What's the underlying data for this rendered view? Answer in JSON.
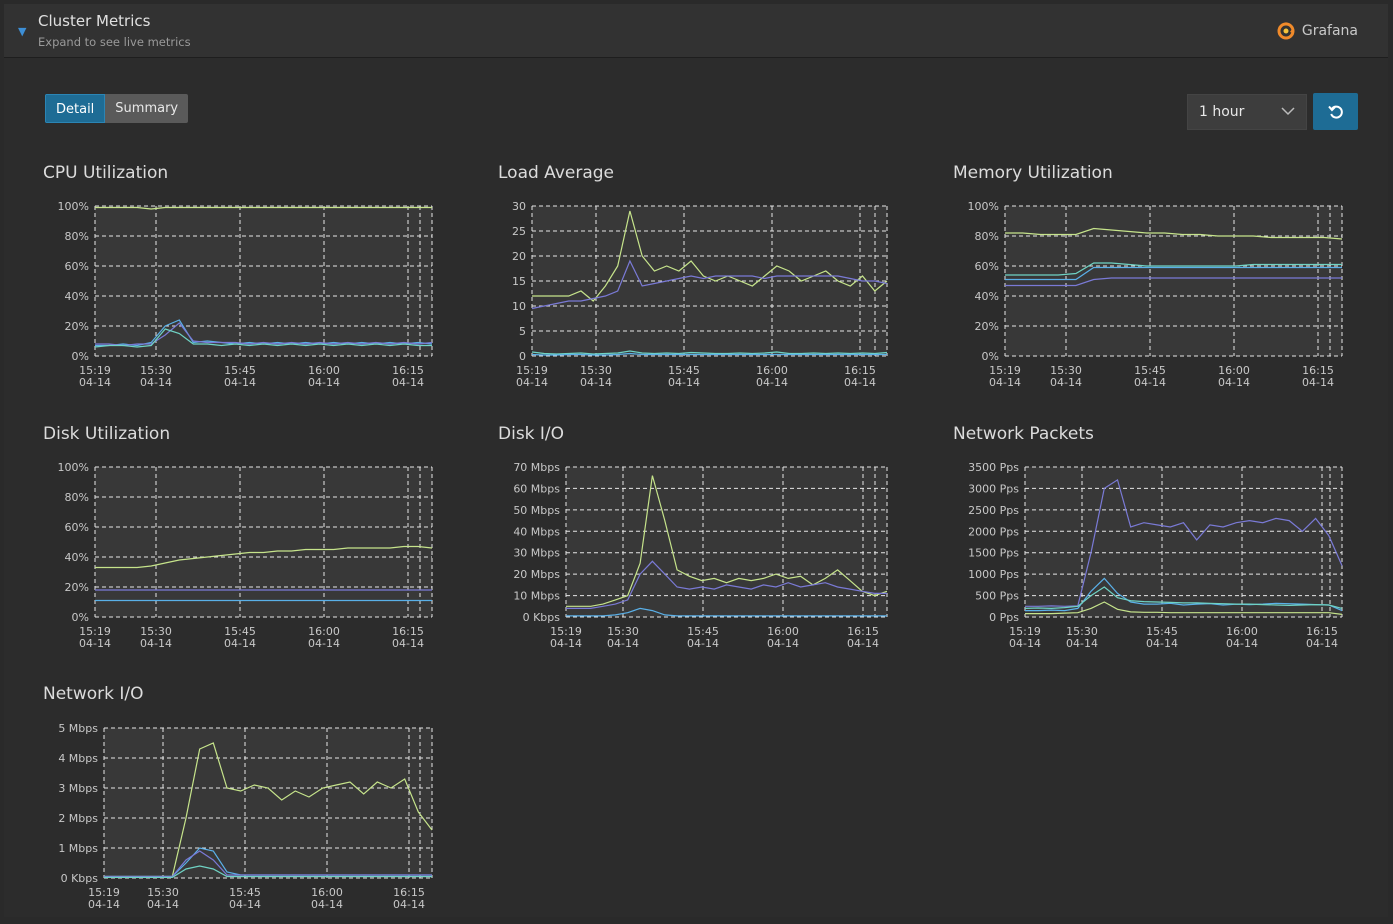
{
  "header": {
    "title": "Cluster Metrics",
    "subtitle": "Expand to see live metrics",
    "brand": "Grafana"
  },
  "view_toggle": {
    "detail": "Detail",
    "summary": "Summary",
    "selected": "Detail"
  },
  "time_range": {
    "value": "1 hour"
  },
  "colors": {
    "green": "#c6e48b",
    "purple": "#7a7ad6",
    "blue": "#5ab0e8",
    "teal": "#6fd3c4",
    "grid": "#e6e6e6",
    "plot_bg": "#383838",
    "accent": "#1e6c95"
  },
  "chart_data": [
    {
      "id": "cpu",
      "title": "CPU Utilization",
      "type": "line",
      "yticks": [
        "0%",
        "20%",
        "40%",
        "60%",
        "80%",
        "100%"
      ],
      "ylim": [
        0,
        100
      ],
      "xticks": [
        {
          "t": "15:19",
          "d": "04-14"
        },
        {
          "t": "15:30",
          "d": "04-14"
        },
        {
          "t": "15:45",
          "d": "04-14"
        },
        {
          "t": "16:00",
          "d": "04-14"
        },
        {
          "t": "16:15",
          "d": "04-14"
        }
      ],
      "series": [
        {
          "color": "green",
          "values": [
            99,
            99,
            99,
            99,
            98,
            99,
            99,
            99,
            99,
            99,
            99,
            99,
            99,
            99,
            99,
            99,
            99,
            99,
            99,
            99,
            99,
            99,
            99,
            99,
            99
          ]
        },
        {
          "color": "blue",
          "values": [
            7,
            7,
            8,
            7,
            9,
            20,
            24,
            9,
            10,
            9,
            8,
            9,
            8,
            9,
            8,
            9,
            8,
            9,
            8,
            9,
            8,
            9,
            8,
            9,
            8
          ]
        },
        {
          "color": "purple",
          "values": [
            8,
            8,
            7,
            8,
            8,
            14,
            22,
            10,
            9,
            9,
            9,
            8,
            9,
            8,
            9,
            8,
            9,
            8,
            9,
            8,
            9,
            8,
            9,
            8,
            9
          ]
        },
        {
          "color": "teal",
          "values": [
            6,
            7,
            7,
            6,
            7,
            18,
            15,
            8,
            8,
            7,
            8,
            7,
            8,
            7,
            8,
            7,
            8,
            7,
            8,
            7,
            8,
            7,
            8,
            7,
            7
          ]
        }
      ]
    },
    {
      "id": "load",
      "title": "Load Average",
      "type": "line",
      "yticks": [
        "0",
        "5",
        "10",
        "15",
        "20",
        "25",
        "30"
      ],
      "ylim": [
        0,
        30
      ],
      "xticks": [
        {
          "t": "15:19",
          "d": "04-14"
        },
        {
          "t": "15:30",
          "d": "04-14"
        },
        {
          "t": "15:45",
          "d": "04-14"
        },
        {
          "t": "16:00",
          "d": "04-14"
        },
        {
          "t": "16:15",
          "d": "04-14"
        }
      ],
      "series": [
        {
          "color": "green",
          "values": [
            12,
            12,
            12,
            12,
            13,
            11,
            14,
            18,
            29,
            20,
            17,
            18,
            17,
            19,
            16,
            15,
            16,
            15,
            14,
            16,
            18,
            17,
            15,
            16,
            17,
            15,
            14,
            16,
            13,
            15
          ]
        },
        {
          "color": "purple",
          "values": [
            9.5,
            10,
            10.5,
            11,
            11,
            11.5,
            12,
            13,
            19,
            14,
            14.5,
            15,
            15.5,
            16,
            15.5,
            16,
            16,
            16,
            16,
            15.5,
            16,
            16,
            16,
            16,
            16,
            16,
            15.5,
            15,
            15,
            14.5
          ]
        },
        {
          "color": "teal",
          "values": [
            0.8,
            0.5,
            0.4,
            0.5,
            0.6,
            0.4,
            0.5,
            0.6,
            1,
            0.6,
            0.5,
            0.6,
            0.5,
            0.7,
            0.6,
            0.5,
            0.5,
            0.6,
            0.5,
            0.6,
            0.8,
            0.5,
            0.5,
            0.6,
            0.5,
            0.6,
            0.5,
            0.6,
            0.5,
            0.7
          ]
        },
        {
          "color": "blue",
          "values": [
            0.3,
            0.2,
            0.2,
            0.3,
            0.3,
            0.2,
            0.2,
            0.3,
            0.5,
            0.3,
            0.3,
            0.3,
            0.3,
            0.3,
            0.3,
            0.3,
            0.3,
            0.3,
            0.3,
            0.3,
            0.3,
            0.3,
            0.3,
            0.3,
            0.3,
            0.3,
            0.3,
            0.3,
            0.3,
            0.3
          ]
        }
      ]
    },
    {
      "id": "mem",
      "title": "Memory Utilization",
      "type": "line",
      "yticks": [
        "0%",
        "20%",
        "40%",
        "60%",
        "80%",
        "100%"
      ],
      "ylim": [
        0,
        100
      ],
      "xticks": [
        {
          "t": "15:19",
          "d": "04-14"
        },
        {
          "t": "15:30",
          "d": "04-14"
        },
        {
          "t": "15:45",
          "d": "04-14"
        },
        {
          "t": "16:00",
          "d": "04-14"
        },
        {
          "t": "16:15",
          "d": "04-14"
        }
      ],
      "series": [
        {
          "color": "green",
          "values": [
            82,
            82,
            81,
            81,
            81,
            85,
            84,
            83,
            82,
            82,
            81,
            81,
            80,
            80,
            80,
            79,
            79,
            79,
            79,
            78
          ]
        },
        {
          "color": "teal",
          "values": [
            54,
            54,
            54,
            54,
            55,
            62,
            62,
            61,
            60,
            60,
            60,
            60,
            60,
            60,
            61,
            61,
            61,
            61,
            61,
            61
          ]
        },
        {
          "color": "blue",
          "values": [
            51,
            51,
            51,
            51,
            51,
            59,
            59,
            59,
            59,
            59,
            59,
            59,
            59,
            59,
            59,
            59,
            59,
            59,
            59,
            59
          ]
        },
        {
          "color": "purple",
          "values": [
            47,
            47,
            47,
            47,
            47,
            51,
            52,
            52,
            52,
            52,
            52,
            52,
            52,
            52,
            52,
            52,
            52,
            52,
            52,
            52
          ]
        }
      ]
    },
    {
      "id": "disk",
      "title": "Disk Utilization",
      "type": "line",
      "yticks": [
        "0%",
        "20%",
        "40%",
        "60%",
        "80%",
        "100%"
      ],
      "ylim": [
        0,
        100
      ],
      "xticks": [
        {
          "t": "15:19",
          "d": "04-14"
        },
        {
          "t": "15:30",
          "d": "04-14"
        },
        {
          "t": "15:45",
          "d": "04-14"
        },
        {
          "t": "16:00",
          "d": "04-14"
        },
        {
          "t": "16:15",
          "d": "04-14"
        }
      ],
      "series": [
        {
          "color": "green",
          "values": [
            33,
            33,
            33,
            33,
            34,
            36,
            38,
            39,
            40,
            41,
            42,
            43,
            43,
            44,
            44,
            45,
            45,
            45,
            46,
            46,
            46,
            46,
            47,
            47,
            46
          ]
        },
        {
          "color": "purple",
          "values": [
            18,
            18,
            18,
            18,
            18,
            18,
            18,
            18,
            18,
            18,
            18,
            18,
            18,
            18,
            18,
            18,
            18,
            18,
            18,
            18,
            18,
            18,
            18,
            18,
            18
          ]
        },
        {
          "color": "blue",
          "values": [
            11,
            11,
            11,
            11,
            11,
            11,
            11,
            11,
            11,
            11,
            11,
            11,
            11,
            11,
            11,
            11,
            11,
            11,
            11,
            11,
            11,
            11,
            11,
            11,
            11
          ]
        }
      ]
    },
    {
      "id": "diskio",
      "title": "Disk I/O",
      "type": "line",
      "yticks": [
        "0 Kbps",
        "10 Mbps",
        "20 Mbps",
        "30 Mbps",
        "40 Mbps",
        "50 Mbps",
        "60 Mbps",
        "70 Mbps"
      ],
      "ylim": [
        0,
        70
      ],
      "xticks": [
        {
          "t": "15:19",
          "d": "04-14"
        },
        {
          "t": "15:30",
          "d": "04-14"
        },
        {
          "t": "15:45",
          "d": "04-14"
        },
        {
          "t": "16:00",
          "d": "04-14"
        },
        {
          "t": "16:15",
          "d": "04-14"
        }
      ],
      "series": [
        {
          "color": "green",
          "values": [
            5,
            5,
            5,
            6,
            8,
            10,
            25,
            66,
            45,
            22,
            19,
            17,
            18,
            16,
            18,
            17,
            18,
            20,
            18,
            19,
            15,
            18,
            22,
            17,
            12,
            10,
            12
          ]
        },
        {
          "color": "purple",
          "values": [
            4,
            4,
            4,
            5,
            6,
            8,
            20,
            26,
            20,
            14,
            13,
            14,
            13,
            15,
            14,
            13,
            15,
            14,
            16,
            14,
            15,
            16,
            14,
            13,
            12,
            11,
            11
          ]
        },
        {
          "color": "blue",
          "values": [
            0.5,
            0.5,
            0.5,
            0.5,
            1,
            2,
            4,
            3,
            1,
            0.5,
            0.5,
            0.5,
            0.5,
            0.5,
            0.5,
            0.5,
            0.5,
            0.5,
            0.5,
            0.5,
            0.5,
            0.5,
            0.5,
            0.5,
            0.5,
            0.5,
            0.5
          ]
        }
      ]
    },
    {
      "id": "netpk",
      "title": "Network Packets",
      "type": "line",
      "yticks": [
        "0 Pps",
        "500 Pps",
        "1000 Pps",
        "1500 Pps",
        "2000 Pps",
        "2500 Pps",
        "3000 Pps",
        "3500 Pps"
      ],
      "ylim": [
        0,
        3500
      ],
      "xticks": [
        {
          "t": "15:19",
          "d": "04-14"
        },
        {
          "t": "15:30",
          "d": "04-14"
        },
        {
          "t": "15:45",
          "d": "04-14"
        },
        {
          "t": "16:00",
          "d": "04-14"
        },
        {
          "t": "16:15",
          "d": "04-14"
        }
      ],
      "series": [
        {
          "color": "purple",
          "values": [
            250,
            250,
            260,
            250,
            260,
            1500,
            3000,
            3200,
            2100,
            2200,
            2150,
            2100,
            2200,
            1800,
            2150,
            2100,
            2200,
            2250,
            2200,
            2300,
            2250,
            2000,
            2300,
            1900,
            1200
          ]
        },
        {
          "color": "blue",
          "values": [
            150,
            150,
            160,
            150,
            200,
            600,
            900,
            550,
            350,
            300,
            300,
            320,
            280,
            300,
            310,
            280,
            300,
            290,
            300,
            320,
            310,
            300,
            290,
            280,
            150
          ]
        },
        {
          "color": "teal",
          "values": [
            200,
            210,
            200,
            220,
            250,
            500,
            700,
            450,
            380,
            360,
            350,
            340,
            330,
            330,
            320,
            310,
            300,
            300,
            290,
            280,
            270,
            280,
            290,
            280,
            200
          ]
        },
        {
          "color": "green",
          "values": [
            80,
            80,
            80,
            90,
            100,
            200,
            350,
            180,
            120,
            110,
            110,
            100,
            100,
            100,
            100,
            100,
            100,
            100,
            100,
            100,
            100,
            100,
            100,
            100,
            60
          ]
        }
      ]
    },
    {
      "id": "netio",
      "title": "Network I/O",
      "type": "line",
      "yticks": [
        "0 Kbps",
        "1 Mbps",
        "2 Mbps",
        "3 Mbps",
        "4 Mbps",
        "5 Mbps"
      ],
      "ylim": [
        0,
        5
      ],
      "xticks": [
        {
          "t": "15:19",
          "d": "04-14"
        },
        {
          "t": "15:30",
          "d": "04-14"
        },
        {
          "t": "15:45",
          "d": "04-14"
        },
        {
          "t": "16:00",
          "d": "04-14"
        },
        {
          "t": "16:15",
          "d": "04-14"
        }
      ],
      "series": [
        {
          "color": "green",
          "values": [
            0.05,
            0.05,
            0.05,
            0.05,
            0.05,
            0.05,
            2,
            4.3,
            4.5,
            3,
            2.9,
            3.1,
            3.0,
            2.6,
            2.9,
            2.7,
            3.0,
            3.1,
            3.2,
            2.8,
            3.2,
            3.0,
            3.3,
            2.2,
            1.6
          ]
        },
        {
          "color": "blue",
          "values": [
            0.05,
            0.05,
            0.05,
            0.05,
            0.05,
            0.05,
            0.5,
            1.0,
            0.9,
            0.2,
            0.1,
            0.1,
            0.1,
            0.1,
            0.1,
            0.1,
            0.1,
            0.1,
            0.1,
            0.1,
            0.1,
            0.1,
            0.1,
            0.1,
            0.1
          ]
        },
        {
          "color": "purple",
          "values": [
            0.05,
            0.05,
            0.05,
            0.05,
            0.05,
            0.05,
            0.6,
            0.9,
            0.6,
            0.1,
            0.1,
            0.1,
            0.1,
            0.1,
            0.1,
            0.1,
            0.1,
            0.1,
            0.1,
            0.1,
            0.1,
            0.1,
            0.1,
            0.1,
            0.1
          ]
        },
        {
          "color": "teal",
          "values": [
            0.02,
            0.02,
            0.02,
            0.02,
            0.02,
            0.02,
            0.3,
            0.4,
            0.3,
            0.05,
            0.05,
            0.05,
            0.05,
            0.05,
            0.05,
            0.05,
            0.05,
            0.05,
            0.05,
            0.05,
            0.05,
            0.05,
            0.05,
            0.05,
            0.05
          ]
        }
      ]
    }
  ]
}
